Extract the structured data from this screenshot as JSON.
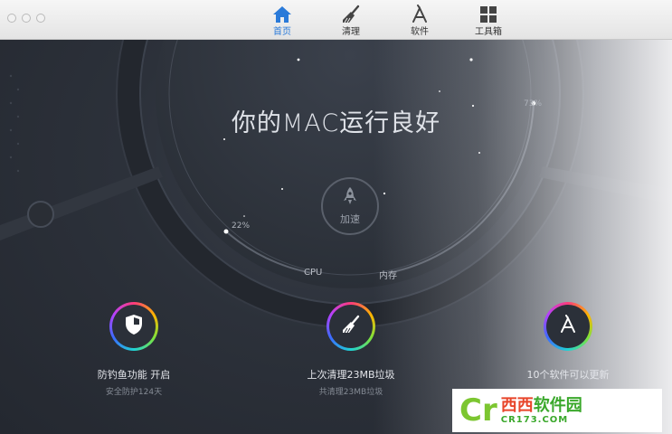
{
  "toolbar": {
    "tabs": [
      {
        "label": "首页",
        "icon": "home-icon",
        "active": true
      },
      {
        "label": "清理",
        "icon": "broom-icon",
        "active": false
      },
      {
        "label": "软件",
        "icon": "app-store-icon",
        "active": false
      },
      {
        "label": "工具箱",
        "icon": "grid-icon",
        "active": false
      }
    ],
    "active_color": "#2a7ad9"
  },
  "main": {
    "headline": "你的MAC运行良好",
    "boost_label": "加速",
    "gauges": {
      "cpu": {
        "label": "CPU",
        "percent": "22%"
      },
      "memory": {
        "label": "内存",
        "percent": "73%"
      }
    },
    "features": [
      {
        "title": "防钓鱼功能 开启",
        "subtitle": "安全防护124天",
        "icon": "shield-icon"
      },
      {
        "title": "上次清理23MB垃圾",
        "subtitle": "共清理23MB垃圾",
        "icon": "broom-icon"
      },
      {
        "title": "10个软件可以更新",
        "subtitle": "",
        "icon": "app-store-icon"
      }
    ]
  },
  "watermark": {
    "logo_glyph": "Cr",
    "name_part1": "西西",
    "name_part2": "软件园",
    "url": "CR173.COM"
  }
}
